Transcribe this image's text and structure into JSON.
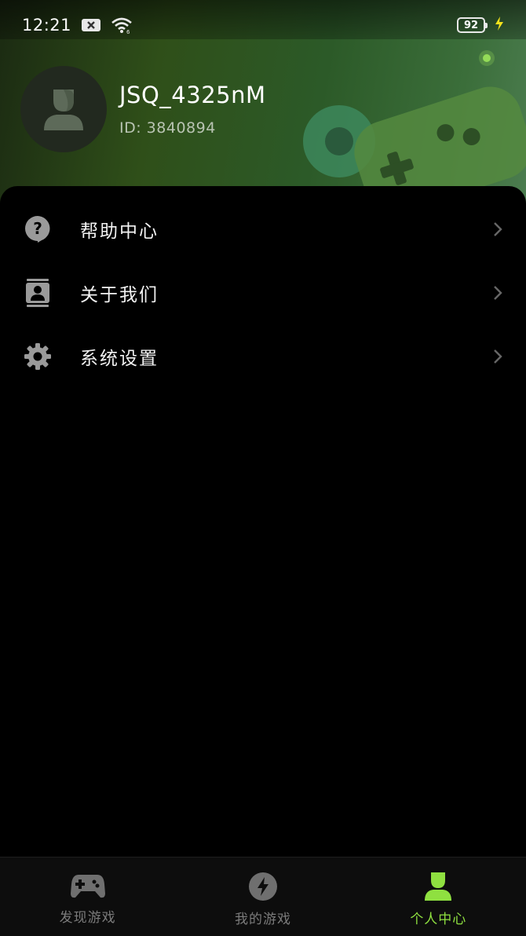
{
  "status_bar": {
    "time": "12:21",
    "battery": "92"
  },
  "profile": {
    "username": "JSQ_4325nM",
    "user_id": "ID: 3840894"
  },
  "menu": [
    {
      "label": "帮助中心",
      "icon": "help-icon"
    },
    {
      "label": "关于我们",
      "icon": "contact-card-icon"
    },
    {
      "label": "系统设置",
      "icon": "gear-icon"
    }
  ],
  "tabs": [
    {
      "label": "发现游戏",
      "icon": "gamepad-icon",
      "active": false
    },
    {
      "label": "我的游戏",
      "icon": "lightning-icon",
      "active": false
    },
    {
      "label": "个人中心",
      "icon": "person-icon",
      "active": true
    }
  ],
  "colors": {
    "accent": "#8fe040",
    "background": "#000000",
    "tab_inactive": "#7b7b7b"
  }
}
